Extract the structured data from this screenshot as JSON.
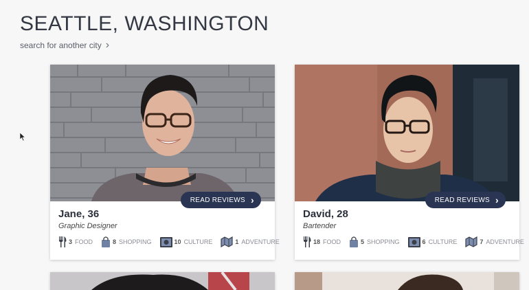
{
  "header": {
    "title": "SEATTLE, WASHINGTON",
    "search_link": "search for another city"
  },
  "colors": {
    "accent": "#2a3553",
    "background": "#f7f7f8"
  },
  "cards": [
    {
      "name": "Jane, 36",
      "job": "Graphic Designer",
      "button": "READ REVIEWS",
      "stats": [
        {
          "count": "3",
          "label": "FOOD",
          "icon": "utensils-icon"
        },
        {
          "count": "8",
          "label": "SHOPPING",
          "icon": "shopping-bag-icon"
        },
        {
          "count": "10",
          "label": "CULTURE",
          "icon": "museum-icon"
        },
        {
          "count": "1",
          "label": "ADVENTURE",
          "icon": "map-icon"
        }
      ]
    },
    {
      "name": "David, 28",
      "job": "Bartender",
      "button": "READ REVIEWS",
      "stats": [
        {
          "count": "18",
          "label": "FOOD",
          "icon": "utensils-icon"
        },
        {
          "count": "5",
          "label": "SHOPPING",
          "icon": "shopping-bag-icon"
        },
        {
          "count": "6",
          "label": "CULTURE",
          "icon": "museum-icon"
        },
        {
          "count": "7",
          "label": "ADVENTURE",
          "icon": "map-icon"
        }
      ]
    }
  ]
}
